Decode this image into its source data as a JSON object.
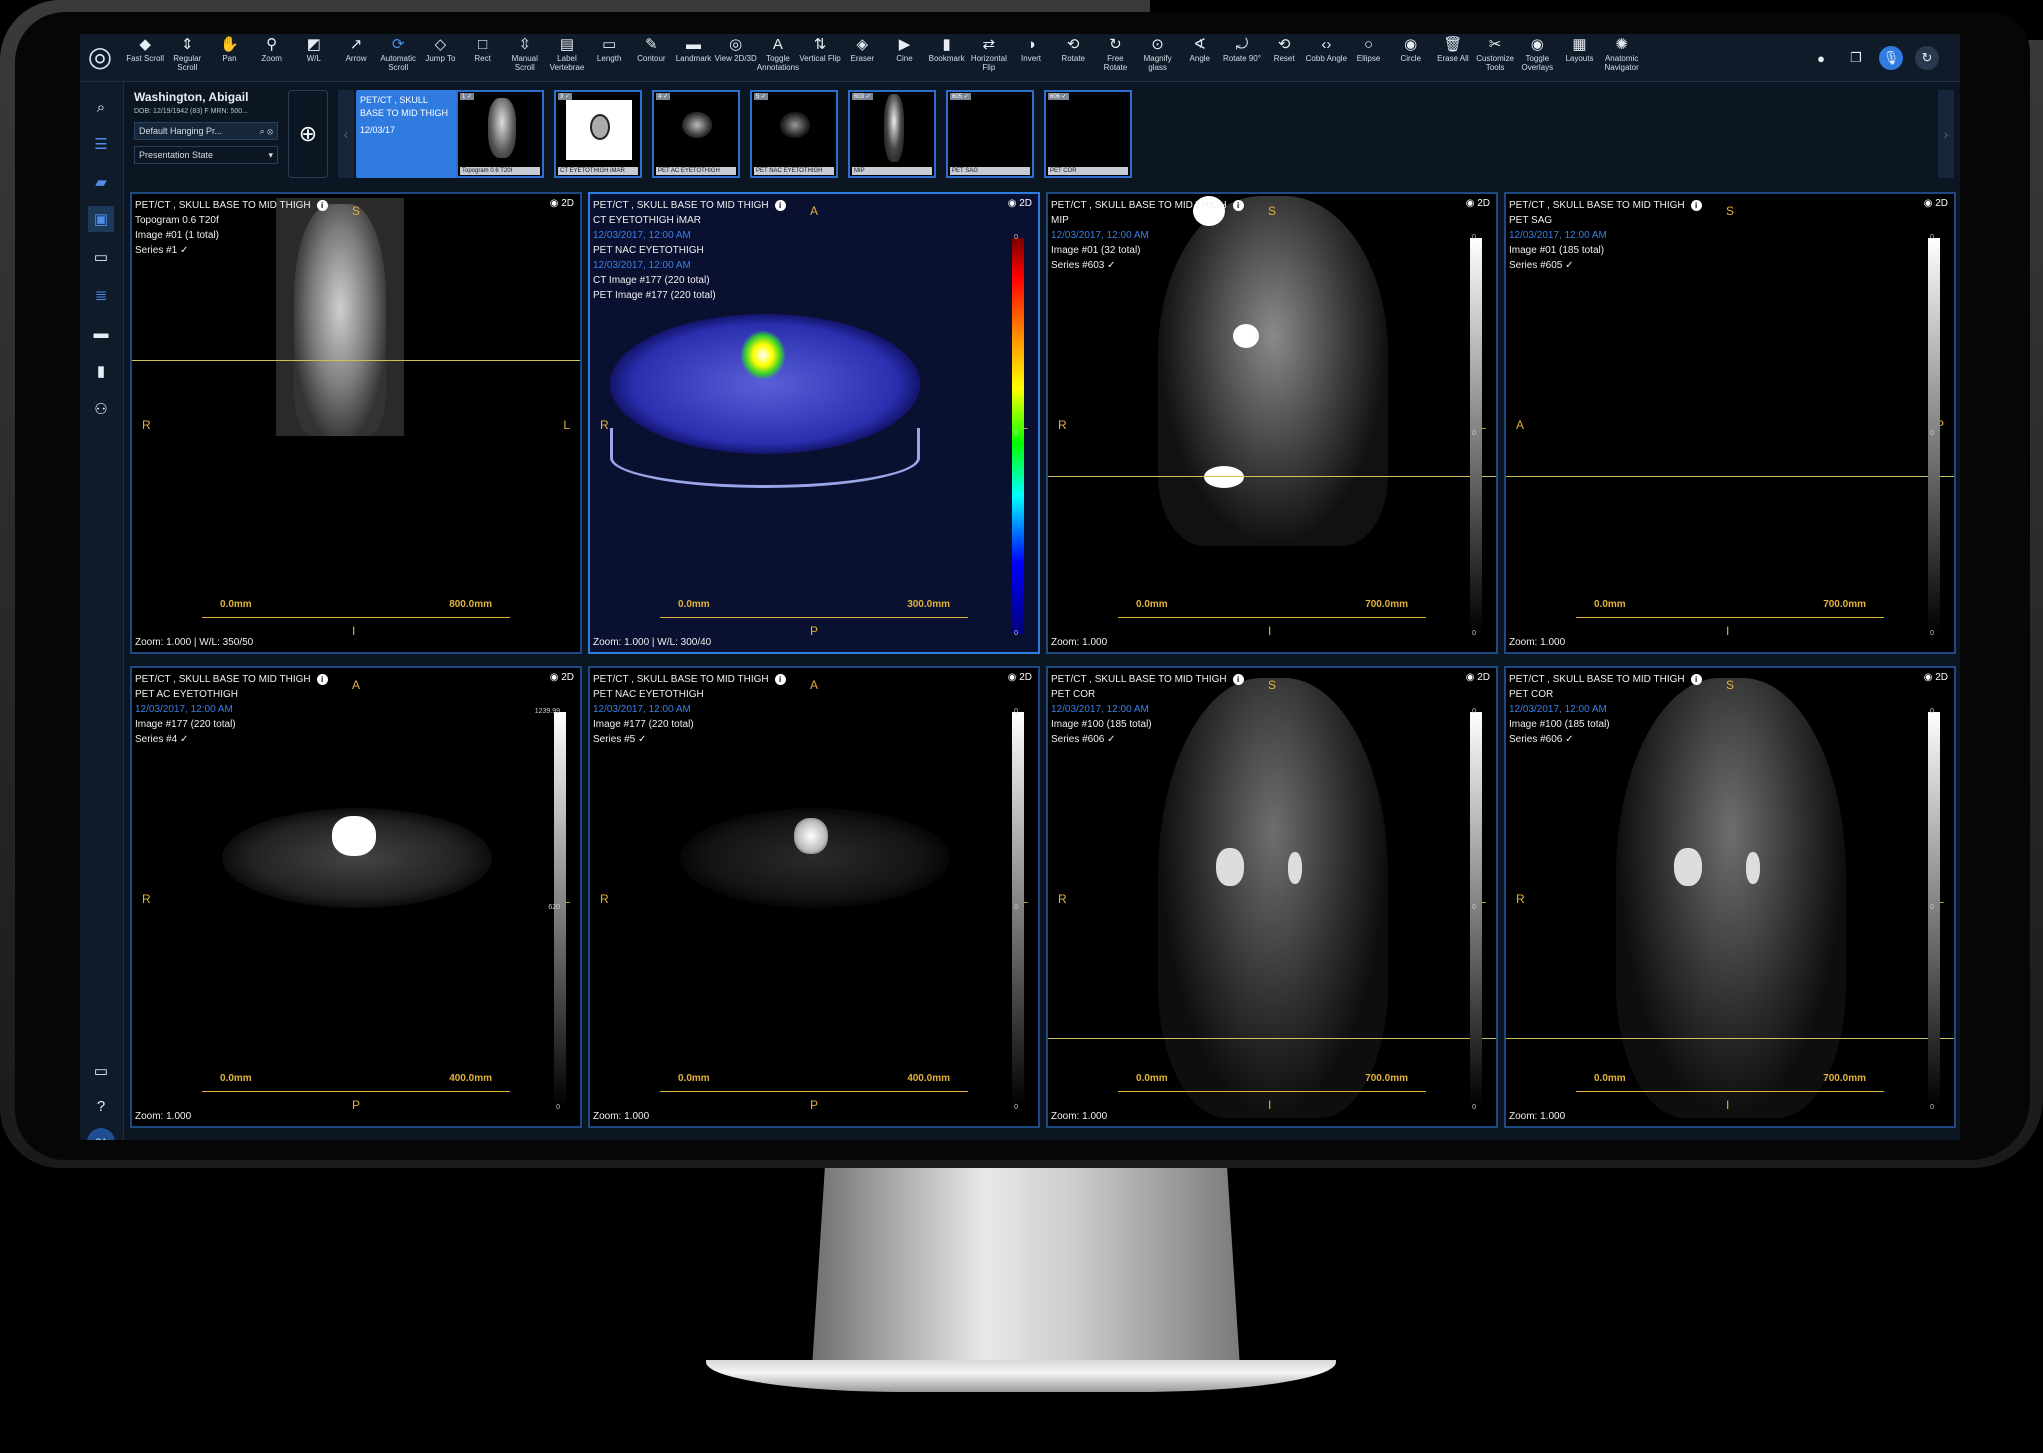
{
  "toolbar": {
    "tools": [
      {
        "label": "Fast Scroll",
        "icon": "layers-icon"
      },
      {
        "label": "Regular Scroll",
        "icon": "scroll-icon"
      },
      {
        "label": "Pan",
        "icon": "hand-icon"
      },
      {
        "label": "Zoom",
        "icon": "zoom-icon"
      },
      {
        "label": "W/L",
        "icon": "window-level-icon"
      },
      {
        "label": "Arrow",
        "icon": "arrow-icon"
      },
      {
        "label": "Automatic Scroll",
        "icon": "auto-scroll-icon",
        "active": true
      },
      {
        "label": "Jump To",
        "icon": "jump-icon"
      },
      {
        "label": "Rect",
        "icon": "rect-icon"
      },
      {
        "label": "Manual Scroll",
        "icon": "manual-scroll-icon"
      },
      {
        "label": "Label Vertebrae",
        "icon": "vertebrae-icon"
      },
      {
        "label": "Length",
        "icon": "ruler-icon"
      },
      {
        "label": "Contour",
        "icon": "contour-icon"
      },
      {
        "label": "Landmark",
        "icon": "landmark-icon"
      },
      {
        "label": "View 2D/3D",
        "icon": "view-3d-icon"
      },
      {
        "label": "Toggle Annotations",
        "icon": "annotation-icon"
      },
      {
        "label": "Vertical Flip",
        "icon": "vflip-icon"
      },
      {
        "label": "Eraser",
        "icon": "eraser-icon"
      },
      {
        "label": "Cine",
        "icon": "play-icon"
      },
      {
        "label": "Bookmark",
        "icon": "bookmark-icon"
      },
      {
        "label": "Horizontal Flip",
        "icon": "hflip-icon"
      },
      {
        "label": "Invert",
        "icon": "invert-icon"
      },
      {
        "label": "Rotate",
        "icon": "rotate-3d-icon"
      },
      {
        "label": "Free Rotate",
        "icon": "free-rotate-icon"
      },
      {
        "label": "Magnify glass",
        "icon": "magnify-icon"
      },
      {
        "label": "Angle",
        "icon": "angle-icon"
      },
      {
        "label": "Rotate 90°",
        "icon": "rotate-90-icon"
      },
      {
        "label": "Reset",
        "icon": "reset-icon"
      },
      {
        "label": "Cobb Angle",
        "icon": "cobb-icon"
      },
      {
        "label": "Ellipse",
        "icon": "ellipse-icon"
      },
      {
        "label": "Circle",
        "icon": "circle-icon"
      },
      {
        "label": "Erase All",
        "icon": "trash-icon"
      },
      {
        "label": "Customize Tools",
        "icon": "tools-icon"
      },
      {
        "label": "Toggle Overlays",
        "icon": "eye-icon"
      },
      {
        "label": "Layouts",
        "icon": "grid-icon"
      },
      {
        "label": "Anatomic Navigator",
        "icon": "navigator-icon"
      }
    ]
  },
  "patient": {
    "name": "Washington, Abigail",
    "dob": "DOB: 12/19/1942 (83)   F   MRN: 500...",
    "hanging": "Default Hanging Pr...",
    "presentation": "Presentation State"
  },
  "study": {
    "title": "PET/CT , SKULL BASE TO MID THIGH",
    "date": "12/03/17",
    "collapse": "> <"
  },
  "thumbnails": [
    {
      "tag": "1 ✓",
      "label": "Topogram 0.6 T20f"
    },
    {
      "tag": "3 ✓",
      "label": "CT EYETOTHIGH iMAR"
    },
    {
      "tag": "4 ✓",
      "label": "PET AC EYETOTHIGH"
    },
    {
      "tag": "5 ✓",
      "label": "PET NAC EYETOTHIGH"
    },
    {
      "tag": "603 ✓",
      "label": "MIP"
    },
    {
      "tag": "605 ✓",
      "label": "PET SAG"
    },
    {
      "tag": "606 ✓",
      "label": "PET COR"
    }
  ],
  "viewports": [
    {
      "study": "PET/CT , SKULL BASE TO MID THIGH",
      "series_name": "Topogram 0.6 T20f",
      "date": "",
      "image": "Image #01 (1 total)",
      "series": "Series #1 ✓",
      "top": "S",
      "bottom": "I",
      "left": "R",
      "right": "L",
      "scale_min": "0.0mm",
      "scale_max": "800.0mm",
      "zoom": "Zoom: 1.000 | W/L: 350/50",
      "cbar": false
    },
    {
      "study": "PET/CT , SKULL BASE TO MID THIGH",
      "series_name": "CT EYETOTHIGH iMAR",
      "date": "12/03/2017, 12:00 AM",
      "line3": "PET NAC EYETOTHIGH",
      "date2": "12/03/2017, 12:00 AM",
      "line5": "CT Image #177 (220 total)",
      "line6": "PET Image #177 (220 total)",
      "top": "A",
      "bottom": "P",
      "left": "R",
      "right": "L",
      "scale_min": "0.0mm",
      "scale_max": "300.0mm",
      "zoom": "Zoom: 1.000 | W/L: 300/40",
      "cbar_max": "0",
      "cbar_mid": "0",
      "cbar_min": "0"
    },
    {
      "study": "PET/CT , SKULL BASE TO MID THIGH",
      "series_name": "MIP",
      "date": "12/03/2017, 12:00 AM",
      "image": "Image #01 (32 total)",
      "series": "Series #603 ✓",
      "top": "S",
      "bottom": "I",
      "left": "R",
      "right": "L",
      "scale_min": "0.0mm",
      "scale_max": "700.0mm",
      "zoom": "Zoom: 1.000",
      "cbar_max": "0",
      "cbar_mid": "0",
      "cbar_min": "0"
    },
    {
      "study": "PET/CT , SKULL BASE TO MID THIGH",
      "series_name": "PET SAG",
      "date": "12/03/2017, 12:00 AM",
      "image": "Image #01 (185 total)",
      "series": "Series #605 ✓",
      "top": "S",
      "bottom": "I",
      "left": "A",
      "right": "P",
      "scale_min": "0.0mm",
      "scale_max": "700.0mm",
      "zoom": "Zoom: 1.000",
      "cbar_max": "0",
      "cbar_mid": "0",
      "cbar_min": "0"
    },
    {
      "study": "PET/CT , SKULL BASE TO MID THIGH",
      "series_name": "PET AC EYETOTHIGH",
      "date": "12/03/2017, 12:00 AM",
      "image": "Image #177 (220 total)",
      "series": "Series #4 ✓",
      "top": "A",
      "bottom": "P",
      "left": "R",
      "right": "L",
      "scale_min": "0.0mm",
      "scale_max": "400.0mm",
      "zoom": "Zoom: 1.000",
      "cbar_max": "1239.99",
      "cbar_mid": "620",
      "cbar_min": "0"
    },
    {
      "study": "PET/CT , SKULL BASE TO MID THIGH",
      "series_name": "PET NAC EYETOTHIGH",
      "date": "12/03/2017, 12:00 AM",
      "image": "Image #177 (220 total)",
      "series": "Series #5 ✓",
      "top": "A",
      "bottom": "P",
      "left": "R",
      "right": "L",
      "scale_min": "0.0mm",
      "scale_max": "400.0mm",
      "zoom": "Zoom: 1.000",
      "cbar_max": "0",
      "cbar_mid": "0",
      "cbar_min": "0"
    },
    {
      "study": "PET/CT , SKULL BASE TO MID THIGH",
      "series_name": "PET COR",
      "date": "12/03/2017, 12:00 AM",
      "image": "Image #100 (185 total)",
      "series": "Series #606 ✓",
      "top": "S",
      "bottom": "I",
      "left": "R",
      "right": "L",
      "scale_min": "0.0mm",
      "scale_max": "700.0mm",
      "zoom": "Zoom: 1.000",
      "cbar_max": "0",
      "cbar_mid": "0",
      "cbar_min": "0"
    },
    {
      "study": "PET/CT , SKULL BASE TO MID THIGH",
      "series_name": "PET COR",
      "date": "12/03/2017, 12:00 AM",
      "image": "Image #100 (185 total)",
      "series": "Series #606 ✓",
      "top": "S",
      "bottom": "I",
      "left": "R",
      "right": "L",
      "scale_min": "0.0mm",
      "scale_max": "700.0mm",
      "zoom": "Zoom: 1.000",
      "cbar_max": "0",
      "cbar_mid": "0",
      "cbar_min": "0"
    }
  ],
  "view_mode": "2D",
  "user_initials": "CA",
  "colors": {
    "accent": "#2f7be0",
    "orientation": "#e2b33b",
    "date": "#3b7fe6"
  }
}
